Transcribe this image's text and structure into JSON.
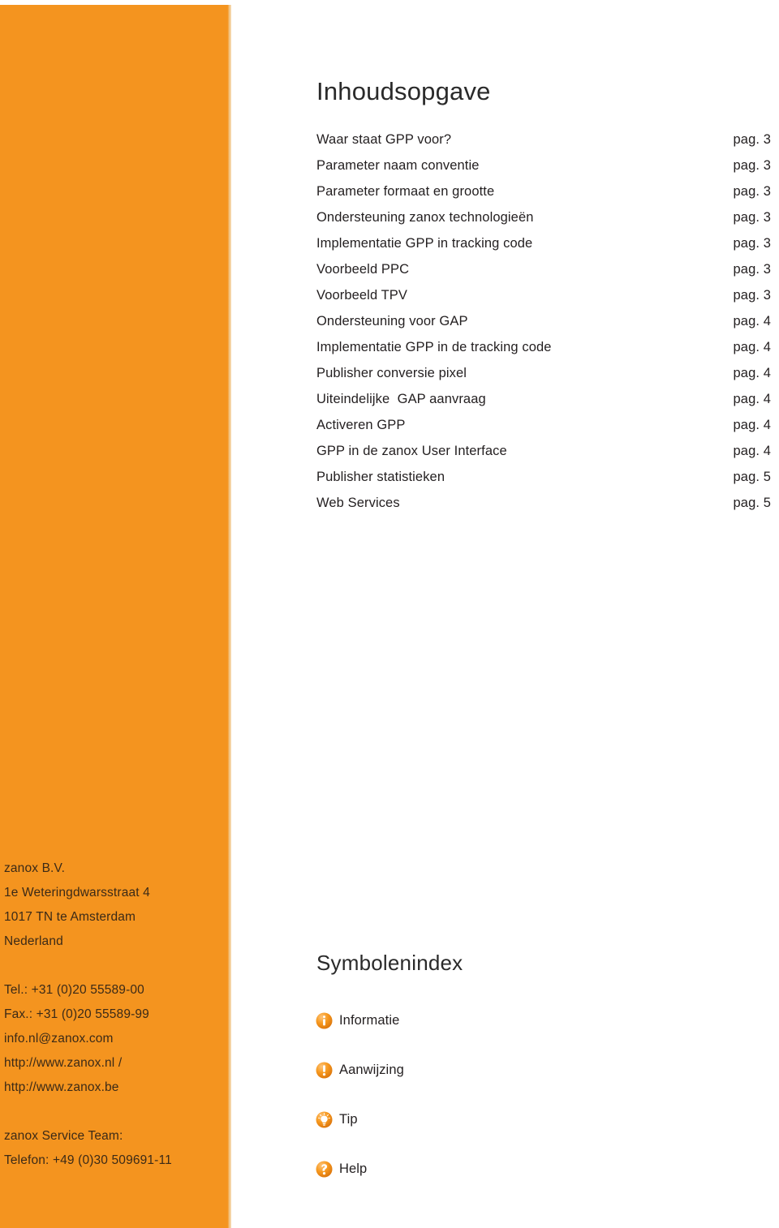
{
  "colors": {
    "brand_orange": "#f4941f",
    "band_edge": "#f6dcb8",
    "text_dark": "#231f20",
    "band_text": "#3b2a17"
  },
  "toc": {
    "title": "Inhoudsopgave",
    "entries": [
      {
        "label": "Waar staat GPP voor?",
        "page": "pag. 3"
      },
      {
        "label": "Parameter naam conventie",
        "page": "pag. 3"
      },
      {
        "label": "Parameter formaat en grootte",
        "page": "pag. 3"
      },
      {
        "label": "Ondersteuning zanox technologieën",
        "page": "pag. 3"
      },
      {
        "label": "Implementatie GPP in tracking code",
        "page": "pag. 3"
      },
      {
        "label": "Voorbeeld PPC",
        "page": "pag. 3"
      },
      {
        "label": "Voorbeeld TPV",
        "page": "pag. 3"
      },
      {
        "label": "Ondersteuning voor GAP",
        "page": "pag. 4"
      },
      {
        "label": "Implementatie GPP in de tracking code",
        "page": "pag. 4"
      },
      {
        "label": "Publisher conversie pixel",
        "page": "pag. 4"
      },
      {
        "label": "Uiteindelijke  GAP aanvraag",
        "page": "pag. 4"
      },
      {
        "label": "Activeren GPP",
        "page": "pag. 4"
      },
      {
        "label": "GPP in de zanox User Interface",
        "page": "pag. 4"
      },
      {
        "label": "Publisher statistieken",
        "page": "pag. 5"
      },
      {
        "label": "Web Services",
        "page": "pag. 5"
      }
    ]
  },
  "contact": {
    "company": "zanox B.V.",
    "street": "1e Weteringdwarsstraat 4",
    "city": "1017 TN te Amsterdam",
    "country": "Nederland",
    "tel": "Tel.: +31 (0)20 55589-00",
    "fax": "Fax.: +31 (0)20 55589-99",
    "email": "info.nl@zanox.com",
    "web": "http://www.zanox.nl / http://www.zanox.be",
    "service_team_label": "zanox Service Team:",
    "service_team_phone": "Telefon: +49 (0)30 509691-11"
  },
  "symbol_index": {
    "title": "Symbolenindex",
    "items": [
      {
        "icon": "info-icon",
        "label": "Informatie"
      },
      {
        "icon": "warning-icon",
        "label": "Aanwijzing"
      },
      {
        "icon": "lightbulb-tip-icon",
        "label": "Tip"
      },
      {
        "icon": "help-question-icon",
        "label": "Help"
      }
    ]
  }
}
